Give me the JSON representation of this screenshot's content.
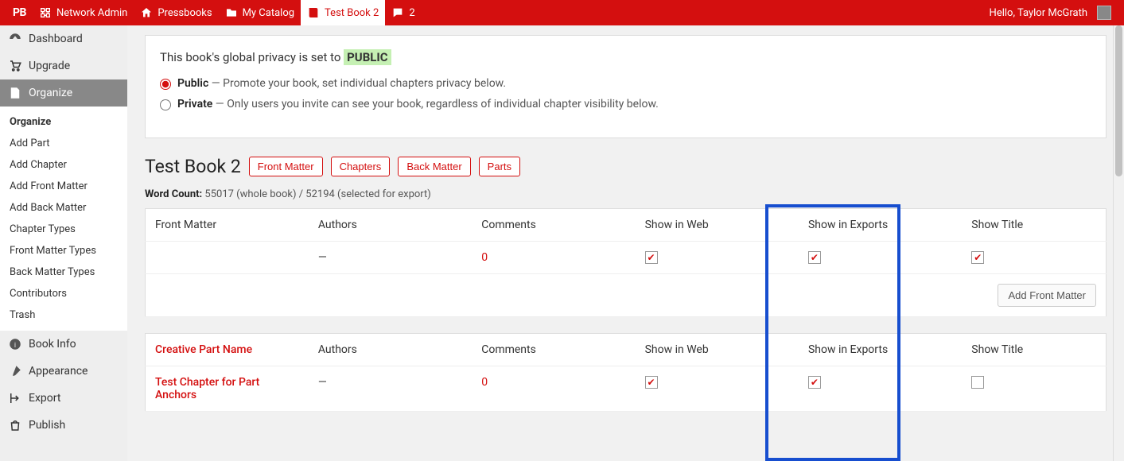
{
  "adminbar": {
    "logo": "PB",
    "network_admin": "Network Admin",
    "pressbooks": "Pressbooks",
    "my_catalog": "My Catalog",
    "current_book": "Test Book 2",
    "comments": "2",
    "greeting": "Hello, Taylor McGrath"
  },
  "sidebar": {
    "dashboard": "Dashboard",
    "upgrade": "Upgrade",
    "organize": "Organize",
    "submenu": {
      "organize": "Organize",
      "add_part": "Add Part",
      "add_chapter": "Add Chapter",
      "add_front_matter": "Add Front Matter",
      "add_back_matter": "Add Back Matter",
      "chapter_types": "Chapter Types",
      "front_matter_types": "Front Matter Types",
      "back_matter_types": "Back Matter Types",
      "contributors": "Contributors",
      "trash": "Trash"
    },
    "book_info": "Book Info",
    "appearance": "Appearance",
    "export": "Export",
    "publish": "Publish"
  },
  "privacy": {
    "headline_prefix": "This book's global privacy is set to ",
    "badge": "PUBLIC",
    "public_label": "Public",
    "public_desc": " — Promote your book, set individual chapters privacy below.",
    "private_label": "Private",
    "private_desc": " — Only users you invite can see your book, regardless of individual chapter visibility below."
  },
  "title": "Test Book 2",
  "buttons": {
    "front_matter": "Front Matter",
    "chapters": "Chapters",
    "back_matter": "Back Matter",
    "parts": "Parts"
  },
  "wordcount": {
    "label": "Word Count:",
    "value": " 55017 (whole book) / 52194 (selected for export)"
  },
  "cols": {
    "fm": "Front Matter",
    "authors": "Authors",
    "comments": "Comments",
    "show_web": "Show in Web",
    "show_exports": "Show in Exports",
    "show_title": "Show Title"
  },
  "fm_row": {
    "authors": "—",
    "comments": "0"
  },
  "add_front_matter": "Add Front Matter",
  "part": {
    "name": "Creative Part Name",
    "authors": "Authors",
    "comments": "Comments",
    "show_web": "Show in Web",
    "show_exports": "Show in Exports",
    "show_title": "Show Title"
  },
  "chapter": {
    "name": "Test Chapter for Part Anchors",
    "authors": "—",
    "comments": "0"
  }
}
